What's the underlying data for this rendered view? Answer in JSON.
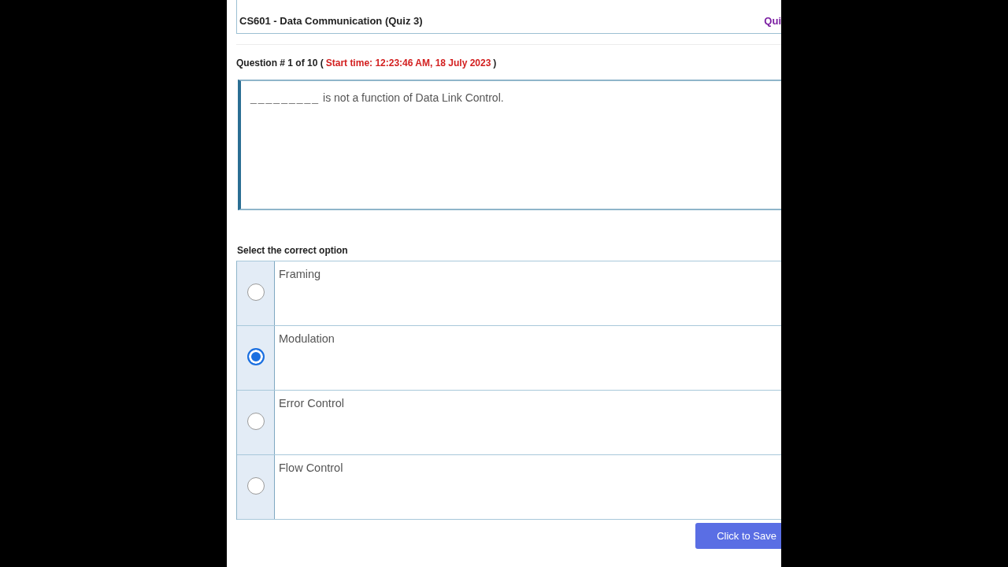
{
  "quiz_header": {
    "title": "CS601 - Data Communication (Quiz 3)",
    "right_label": "Qui"
  },
  "question_info": {
    "prefix": "Question # 1 of 10 (",
    "start_time": "Start time: 12:23:46 AM, 18 July 2023",
    "suffix": ")"
  },
  "question": {
    "blank": "_________",
    "text": "is not a function of Data Link Control."
  },
  "options_heading": "Select the correct option",
  "options": [
    {
      "label": "Framing",
      "selected": false
    },
    {
      "label": "Modulation",
      "selected": true
    },
    {
      "label": "Error Control",
      "selected": false
    },
    {
      "label": "Flow Control",
      "selected": false
    }
  ],
  "save_button": "Click to Save"
}
